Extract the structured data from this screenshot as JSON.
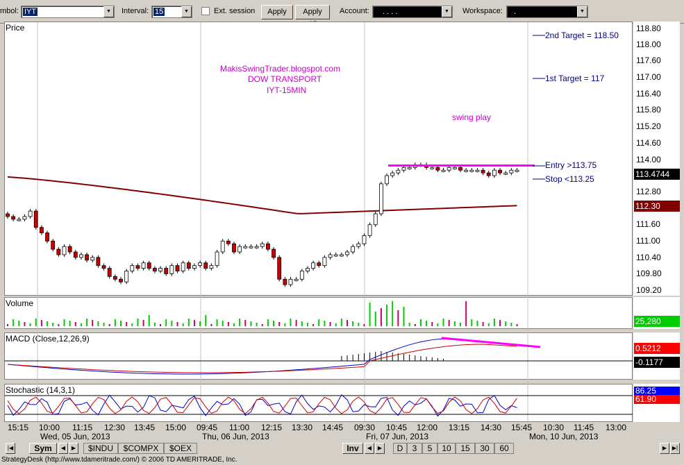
{
  "toolbar": {
    "symbol_label": "mbol:",
    "symbol_value": "IYT",
    "interval_label": "Interval:",
    "interval_value": "15",
    "ext_session_label": "Ext. session",
    "apply_label": "Apply",
    "apply_all_label": "Apply All",
    "account_label": "Account:",
    "account_value": ".   .   .   .",
    "workspace_label": "Workspace:",
    "workspace_value": "."
  },
  "price_panel": {
    "title": "Price",
    "axis_labels": [
      "118.80",
      "118.00",
      "117.60",
      "117.00",
      "116.40",
      "115.80",
      "115.20",
      "114.60",
      "114.00",
      "113.40",
      "112.80",
      "111.60",
      "111.00",
      "110.40",
      "109.80",
      "109.20"
    ],
    "last_price": "113.4744",
    "ma_value": "112.30",
    "annotations": {
      "blog": "MakisSwingTrader.blogspot.com",
      "index": "DOW TRANSPORT",
      "symbol": "IYT-15MIN",
      "swing": "swing play",
      "target2": "2nd Target = 118.50",
      "target1": "1st Target = 117",
      "entry": "Entry >113.75",
      "stop": "Stop <113.25"
    }
  },
  "volume_panel": {
    "title": "Volume",
    "value": "25,280"
  },
  "macd_panel": {
    "title": "MACD (Close,12,26,9)",
    "value1": "0.5212",
    "value2": "-0.1177"
  },
  "stoch_panel": {
    "title": "Stochastic (14,3,1)",
    "value1": "86.25",
    "value2": "61.90"
  },
  "time_axis": {
    "times": [
      "15:15",
      "10:00",
      "11:15",
      "12:30",
      "13:45",
      "15:00",
      "09:45",
      "11:00",
      "12:15",
      "13:30",
      "14:45",
      "09:30",
      "10:45",
      "12:00",
      "13:15",
      "14:30",
      "15:45",
      "10:30",
      "11:45",
      "13:00"
    ],
    "dates": [
      "Wed, 05 Jun, 2013",
      "Thu, 06 Jun, 2013",
      "Fri, 07 Jun, 2013",
      "Mon, 10 Jun, 2013"
    ]
  },
  "tabs": {
    "sym": "Sym",
    "symbols": [
      "$INDU",
      "$COMPX",
      "$OEX"
    ],
    "inv": "Inv",
    "intervals": [
      "D",
      "3",
      "5",
      "10",
      "15",
      "30",
      "60"
    ]
  },
  "status_text": "StrategyDesk (http://www.tdameritrade.com/) © 2006 TD AMERITRADE, Inc.",
  "colors": {
    "annotation": "#cc00cc",
    "target_text": "#000080",
    "ma_line": "#800000",
    "up_candle": "#ffffff",
    "down_candle": "#cc0000",
    "volume_up": "#00cc00"
  },
  "chart_data": {
    "type": "candlestick",
    "y_range": [
      109.2,
      118.8
    ],
    "candles_close": [
      111.9,
      111.8,
      111.8,
      111.9,
      112.1,
      111.5,
      111.3,
      111.0,
      110.7,
      110.5,
      110.8,
      110.6,
      110.4,
      110.5,
      110.3,
      110.4,
      110.1,
      110.0,
      109.7,
      109.6,
      109.5,
      109.9,
      110.1,
      110.0,
      110.2,
      110.0,
      109.9,
      110.0,
      109.8,
      110.1,
      109.9,
      110.2,
      110.0,
      110.1,
      110.2,
      110.0,
      110.1,
      110.6,
      111.0,
      110.9,
      110.6,
      110.8,
      110.8,
      110.8,
      110.8,
      110.9,
      110.7,
      110.4,
      109.6,
      109.4,
      109.6,
      109.6,
      109.9,
      110.0,
      110.2,
      110.1,
      110.4,
      110.5,
      110.5,
      110.5,
      110.6,
      110.8,
      110.9,
      111.2,
      111.6,
      112.0,
      113.1,
      113.4,
      113.5,
      113.6,
      113.7,
      113.7,
      113.8,
      113.8,
      113.7,
      113.7,
      113.6,
      113.6,
      113.7,
      113.7,
      113.6,
      113.6,
      113.6,
      113.6,
      113.5,
      113.4,
      113.6,
      113.5,
      113.5,
      113.6,
      113.6
    ],
    "ma_values": [
      113.35,
      112.3
    ],
    "levels": {
      "entry": 113.75,
      "stop": 113.25,
      "target1": 117.0,
      "target2": 118.5,
      "resistance": 113.77
    }
  }
}
